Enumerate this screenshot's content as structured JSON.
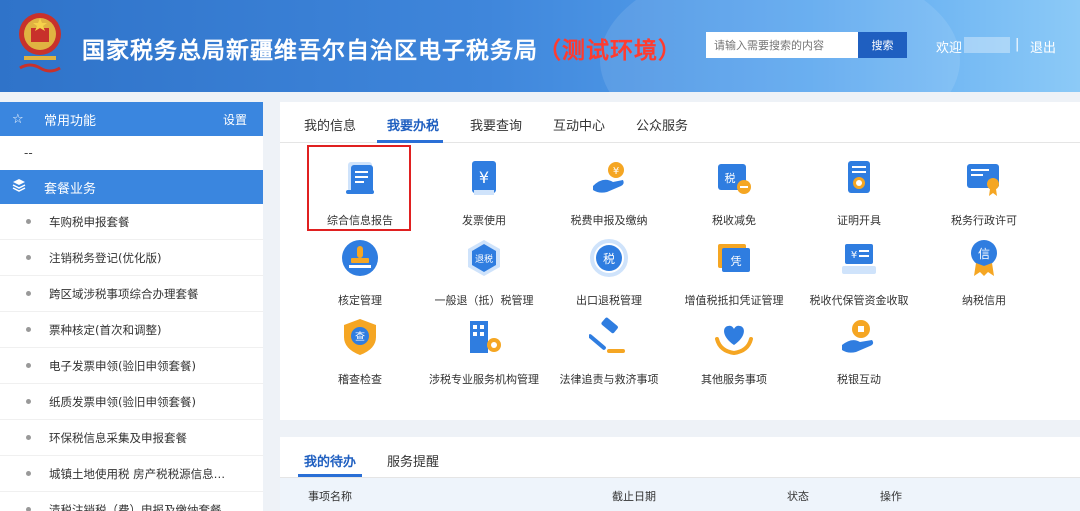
{
  "header": {
    "title": "国家税务总局新疆维吾尔自治区电子税务局",
    "env": "（测试环境）",
    "search_placeholder": "请输入需要搜索的内容",
    "search_button": "搜索",
    "welcome": "欢迎",
    "separator": "|",
    "logout": "退出"
  },
  "sidebar": {
    "favorites_title": "常用功能",
    "favorites_action": "设置",
    "favorites_empty": "--",
    "package_title": "套餐业务",
    "items": [
      "车购税申报套餐",
      "注销税务登记(优化版)",
      "跨区域涉税事项综合办理套餐",
      "票种核定(首次和调整)",
      "电子发票申领(验旧申领套餐)",
      "纸质发票申领(验旧申领套餐)",
      "环保税信息采集及申报套餐",
      "城镇土地使用税 房产税税源信息…",
      "清税注销税（费）申报及缴纳套餐"
    ]
  },
  "main": {
    "tabs": [
      "我的信息",
      "我要办税",
      "我要查询",
      "互动中心",
      "公众服务"
    ],
    "active_tab": "我要办税",
    "services": [
      {
        "label": "综合信息报告",
        "icon": "document-report-icon"
      },
      {
        "label": "发票使用",
        "icon": "invoice-yuan-icon"
      },
      {
        "label": "税费申报及缴纳",
        "icon": "hand-coin-icon"
      },
      {
        "label": "税收减免",
        "icon": "tax-reduction-icon"
      },
      {
        "label": "证明开具",
        "icon": "certificate-icon"
      },
      {
        "label": "税务行政许可",
        "icon": "license-badge-icon"
      },
      {
        "label": "核定管理",
        "icon": "stamp-icon"
      },
      {
        "label": "一般退（抵）税管理",
        "icon": "refund-hexagon-icon"
      },
      {
        "label": "出口退税管理",
        "icon": "export-refund-icon"
      },
      {
        "label": "增值税抵扣凭证管理",
        "icon": "voucher-ticket-icon"
      },
      {
        "label": "税收代保管资金收取",
        "icon": "custody-fund-icon"
      },
      {
        "label": "纳税信用",
        "icon": "credit-medal-icon"
      },
      {
        "label": "稽查检查",
        "icon": "inspection-shield-icon"
      },
      {
        "label": "涉税专业服务机构管理",
        "icon": "building-gear-icon"
      },
      {
        "label": "法律追责与救济事项",
        "icon": "gavel-icon"
      },
      {
        "label": "其他服务事项",
        "icon": "heart-hands-icon"
      },
      {
        "label": "税银互动",
        "icon": "bank-coin-icon"
      }
    ]
  },
  "todo": {
    "tabs": [
      "我的待办",
      "服务提醒"
    ],
    "columns": [
      "事项名称",
      "截止日期",
      "状态",
      "操作"
    ]
  },
  "colors": {
    "header_blue": "#3f86db",
    "accent_blue": "#2a6fd6",
    "icon_blue": "#2f7de0",
    "icon_light": "#cfe3fb",
    "icon_orange": "#f5a623",
    "env_red": "#ff3b2f",
    "highlight_red": "#e02020"
  }
}
